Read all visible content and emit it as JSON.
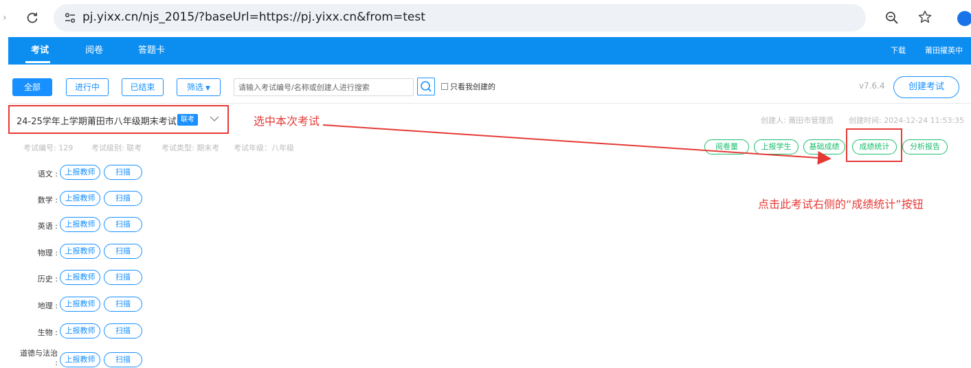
{
  "browser": {
    "url": "pj.yixx.cn/njs_2015/?baseUrl=https://pj.yixx.cn&from=test",
    "back_icon": "chevron-right-icon",
    "reload_icon": "reload-icon",
    "site_info_icon": "tune-icon",
    "zoom_icon": "zoom-icon",
    "bookmark_icon": "star-icon"
  },
  "nav": {
    "items": [
      "考试",
      "阅卷",
      "答题卡"
    ],
    "download": "下载",
    "user": "莆田擢英中"
  },
  "toolbar": {
    "filters": [
      "全部",
      "进行中",
      "已结束"
    ],
    "filter_dropdown": "筛选",
    "search_placeholder": "请输入考试编号/名称或创建人进行搜索",
    "only_mine": "只看我创建的",
    "version": "v7.6.4",
    "create_exam": "创建考试"
  },
  "exam": {
    "title": "24-25学年上学期莆田市八年级期末考试",
    "badge": "联考",
    "creator": "创建人: 莆田市管理员",
    "created_time": "创建时间: 2024-12-24 11:53:35",
    "meta": [
      "考试编号: 129",
      "考试级别: 联考",
      "考试类型: 期末考",
      "考试年级：八年级"
    ],
    "actions": [
      "阅卷量",
      "上报学生",
      "基础成绩",
      "成绩统计",
      "分析报告"
    ]
  },
  "annotations": {
    "select_exam": "选中本次考试",
    "click_stats": "点击此考试右侧的“成绩统计”按钮"
  },
  "subjects": [
    {
      "name": "语文 :",
      "report": "上报教师",
      "scan": "扫描"
    },
    {
      "name": "数学 :",
      "report": "上报教师",
      "scan": "扫描"
    },
    {
      "name": "英语 :",
      "report": "上报教师",
      "scan": "扫描"
    },
    {
      "name": "物理 :",
      "report": "上报教师",
      "scan": "扫描"
    },
    {
      "name": "历史 :",
      "report": "上报教师",
      "scan": "扫描"
    },
    {
      "name": "地理 :",
      "report": "上报教师",
      "scan": "扫描"
    },
    {
      "name": "生物 :",
      "report": "上报教师",
      "scan": "扫描"
    },
    {
      "name": "道德与法治 :",
      "report": "上报教师",
      "scan": "扫描"
    }
  ],
  "colors": {
    "nav": "#0c8ef1",
    "primary": "#1890ff",
    "action_green": "#19be6b",
    "annotation_red": "#e53935"
  }
}
